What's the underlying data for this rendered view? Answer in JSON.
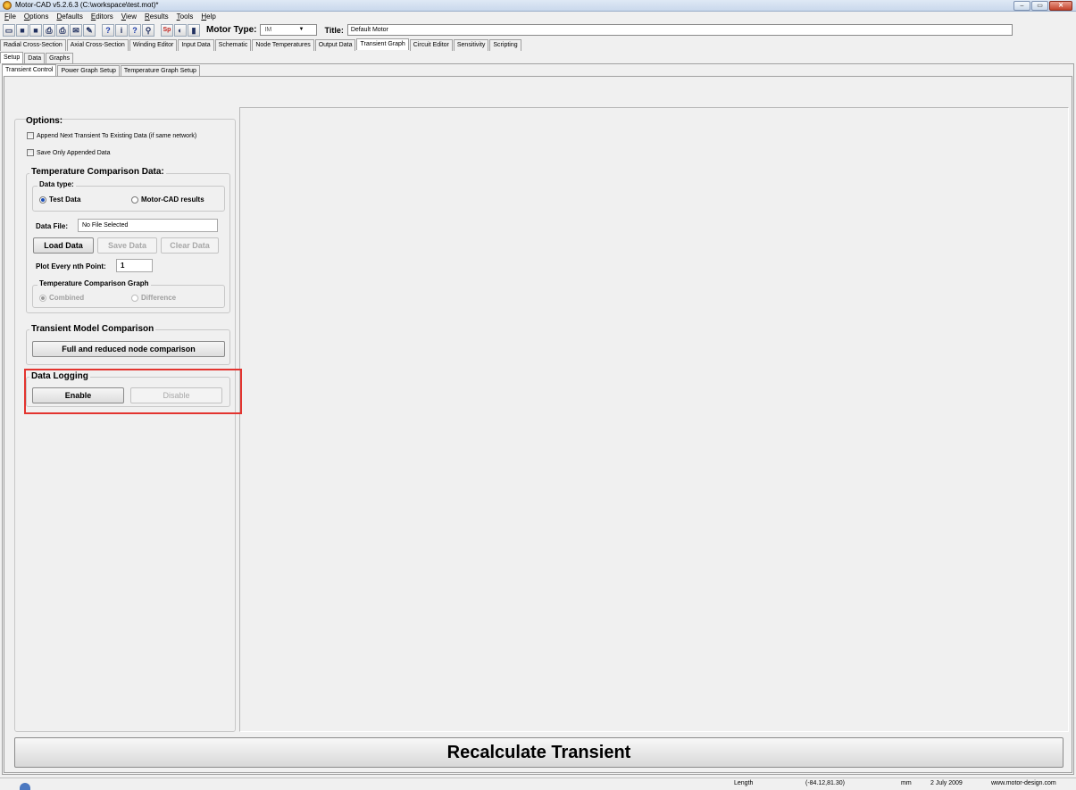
{
  "window": {
    "title": "Motor-CAD v5.2.6.3 (C:\\workspace\\test.mot)*",
    "min": "‒",
    "max": "▭",
    "close": "✕"
  },
  "menu": [
    "File",
    "Options",
    "Defaults",
    "Editors",
    "View",
    "Results",
    "Tools",
    "Help"
  ],
  "toolbar": {
    "icons": [
      "open-icon",
      "save-icon",
      "save-as-icon",
      "print-icon",
      "print-preview-icon",
      "export-icon",
      "graph-icon",
      "help-icon",
      "info-icon",
      "whats-this-icon",
      "tips-icon",
      "sp-icon",
      "options-icon",
      "motor-icon"
    ],
    "glyphs": [
      "▭",
      "■",
      "■",
      "⎙",
      "⎙",
      "✉",
      "✎",
      "?",
      "i",
      "?",
      "⚲",
      "Sp",
      "◐",
      "▮"
    ],
    "motor_type_label": "Motor Type:",
    "motor_type_value": "IM",
    "motor_type_arrow": "▼",
    "title_label": "Title:",
    "title_value": "Default Motor"
  },
  "main_tabs": [
    "Radial Cross-Section",
    "Axial Cross-Section",
    "Winding Editor",
    "Input Data",
    "Schematic",
    "Node Temperatures",
    "Output Data",
    "Transient Graph",
    "Circuit Editor",
    "Sensitivity",
    "Scripting"
  ],
  "main_tab_active": 7,
  "sub_tabs": [
    "Setup",
    "Data",
    "Graphs"
  ],
  "sub_tab_active": 0,
  "setup_tabs": [
    "Transient Control",
    "Power Graph Setup",
    "Temperature Graph Setup"
  ],
  "setup_tab_active": 0,
  "options": {
    "title": "Options:",
    "append_label": "Append Next Transient To Existing Data (if same network)",
    "save_only_label": "Save Only Appended Data"
  },
  "temp_comparison": {
    "title": "Temperature Comparison Data:",
    "data_type_label": "Data type:",
    "radio_test": "Test Data",
    "radio_motorcad": "Motor-CAD results",
    "data_file_label": "Data File:",
    "data_file_value": "No File Selected",
    "load": "Load Data",
    "save": "Save Data",
    "clear": "Clear Data",
    "plot_every_label": "Plot Every nth Point:",
    "plot_every_value": "1",
    "graph_title": "Temperature Comparison Graph",
    "radio_combined": "Combined",
    "radio_difference": "Difference"
  },
  "transient_model": {
    "title": "Transient Model Comparison",
    "button": "Full and reduced node comparison"
  },
  "data_logging": {
    "title": "Data Logging",
    "enable": "Enable",
    "disable": "Disable"
  },
  "recalc_label": "Recalculate Transient",
  "status": {
    "length_label": "Length",
    "coords": "(-84.12,81.30)",
    "unit": "mm",
    "date": "2 July 2009",
    "website": "www.motor-design.com"
  },
  "colors": {
    "highlight": "#e3342f",
    "radio_selected": "#1b4fb8"
  }
}
